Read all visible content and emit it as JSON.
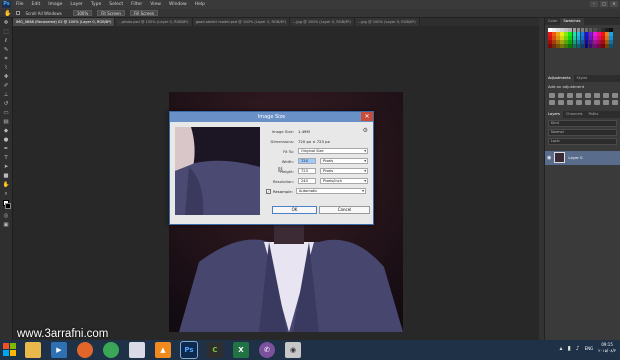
{
  "menu": {
    "logo": "Ps",
    "items": [
      "File",
      "Edit",
      "Image",
      "Layer",
      "Type",
      "Select",
      "Filter",
      "View",
      "Window",
      "Help"
    ],
    "window_buttons": [
      "–",
      "□",
      "✕"
    ]
  },
  "options_bar": {
    "scroll_all_label": "Scroll All Windows",
    "buttons": [
      "100%",
      "Fit Screen",
      "Fill Screen"
    ]
  },
  "tabs": [
    {
      "label": "IMG_0868 (Recovered) 02 @ 100% (Layer 0, RGB/8*)",
      "active": true
    },
    {
      "label": "...photo.psd @ 100% (Layer 0, RGB/8*)",
      "active": false
    },
    {
      "label": "good atelier model.psd @ 100% (Layer 2, RGB/8*)",
      "active": false
    },
    {
      "label": "...jpg @ 100% (Layer 0, RGB/8*)",
      "active": false
    },
    {
      "label": "...jpg @ 100% (Layer 0, RGB/8*)",
      "active": false
    }
  ],
  "right_panel": {
    "top_tabs": [
      "Color",
      "Swatches"
    ],
    "adjustments_tabs": [
      "Adjustments",
      "Styles"
    ],
    "adjustments_title": "Add an adjustment",
    "layers_tabs": [
      "Layers",
      "Channels",
      "Paths"
    ],
    "kind_label": "Kind",
    "blend_label": "Normal",
    "lock_label": "Lock:",
    "layer_name": "Layer 0"
  },
  "dialog": {
    "title": "Image Size",
    "image_size_label": "Image Size:",
    "image_size_value": "1.49M",
    "dimensions_label": "Dimensions:",
    "dimensions_value": "720 px × 723 px",
    "fit_to_label": "Fit To:",
    "fit_to_value": "Original Size",
    "width_label": "Width:",
    "width_value": "720",
    "width_unit": "Pixels",
    "height_label": "Height:",
    "height_value": "723",
    "height_unit": "Pixels",
    "resolution_label": "Resolution:",
    "resolution_value": "240",
    "resolution_unit": "Pixels/Inch",
    "resample_label": "Resample:",
    "resample_value": "Automatic",
    "ok_label": "OK",
    "cancel_label": "Cancel"
  },
  "watermark": "www.3arrafni.com",
  "taskbar": {
    "icons": [
      "folder",
      "media",
      "firefox",
      "chrome",
      "paint",
      "vlc",
      "photoshop",
      "camtasia",
      "excel",
      "viber",
      "camera"
    ],
    "lang": "ENG",
    "time": "09:15",
    "date": "۲۰۱۵/۰۸/۳"
  },
  "colors": {
    "accent": "#6a90c8",
    "close": "#c84b3c",
    "taskbar": "#1e3146"
  }
}
